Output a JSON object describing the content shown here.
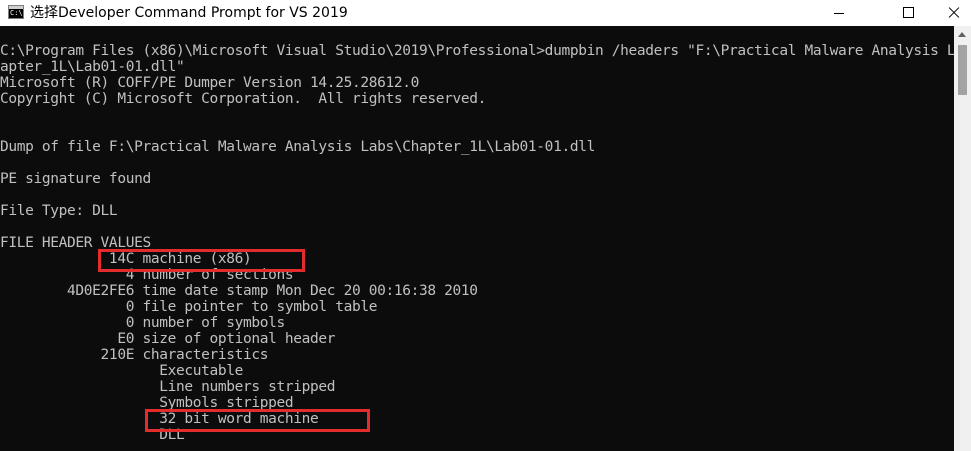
{
  "window": {
    "title": "选择Developer Command Prompt for VS 2019"
  },
  "terminal": {
    "lines": [
      "C:\\Program Files (x86)\\Microsoft Visual Studio\\2019\\Professional>dumpbin /headers \"F:\\Practical Malware Analysis Labs\\Ch",
      "apter_1L\\Lab01-01.dll\"",
      "Microsoft (R) COFF/PE Dumper Version 14.25.28612.0",
      "Copyright (C) Microsoft Corporation.  All rights reserved.",
      "",
      "",
      "Dump of file F:\\Practical Malware Analysis Labs\\Chapter_1L\\Lab01-01.dll",
      "",
      "PE signature found",
      "",
      "File Type: DLL",
      "",
      "FILE HEADER VALUES",
      "             14C machine (x86)",
      "               4 number of sections",
      "        4D0E2FE6 time date stamp Mon Dec 20 00:16:38 2010",
      "               0 file pointer to symbol table",
      "               0 number of symbols",
      "              E0 size of optional header",
      "            210E characteristics",
      "                   Executable",
      "                   Line numbers stripped",
      "                   Symbols stripped",
      "                   32 bit word machine",
      "                   DLL"
    ]
  },
  "colors": {
    "console_background": "#0c0c0c",
    "console_text": "#c0c0c0",
    "highlight_box": "#e32d2d"
  }
}
